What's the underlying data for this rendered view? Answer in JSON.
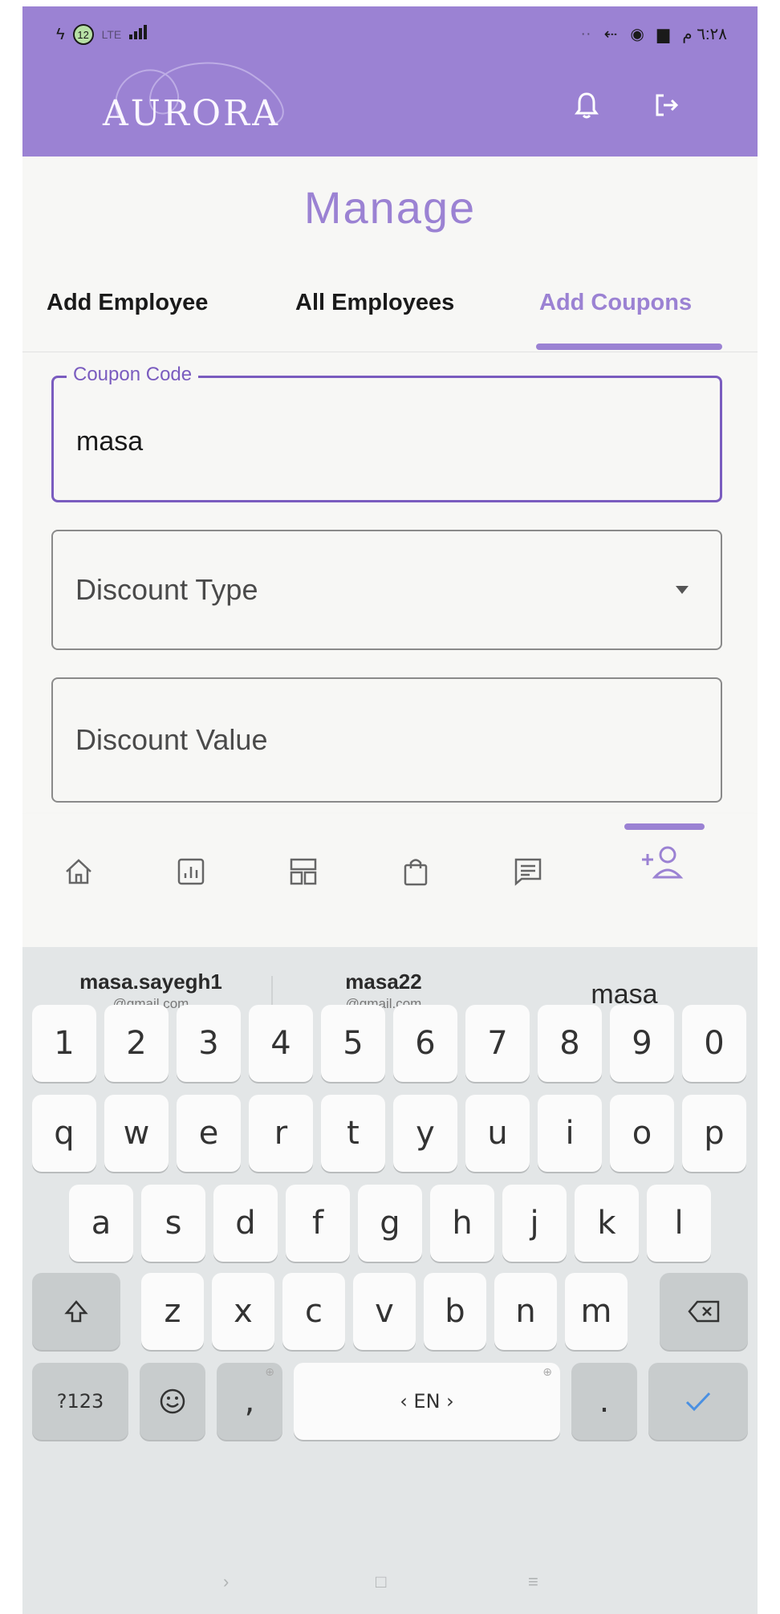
{
  "status_bar": {
    "left_badge": "12",
    "left_text": "LTE",
    "time": "٦:٢٨ م"
  },
  "header": {
    "logo": "AURORA",
    "icons": [
      "bell-icon",
      "logout-icon"
    ]
  },
  "page": {
    "title": "Manage",
    "tabs": [
      {
        "label": "Add Employee",
        "active": false
      },
      {
        "label": "All Employees",
        "active": false
      },
      {
        "label": "Add Coupons",
        "active": true
      }
    ]
  },
  "form": {
    "coupon_code": {
      "label": "Coupon Code",
      "value": "masa"
    },
    "discount_type": {
      "label": "Discount Type"
    },
    "discount_value": {
      "label": "Discount Value"
    }
  },
  "bottom_nav": {
    "items": [
      "home-icon",
      "chart-icon",
      "dashboard-icon",
      "shopping-bag-icon",
      "message-icon",
      "add-person-icon"
    ],
    "active_index": 5
  },
  "keyboard": {
    "suggestions": [
      {
        "main": "masa.sayegh1",
        "sub": "@gmail.com"
      },
      {
        "main": "masa22",
        "sub": "@gmail.com"
      },
      {
        "main": "masa"
      }
    ],
    "row1": [
      "1",
      "2",
      "3",
      "4",
      "5",
      "6",
      "7",
      "8",
      "9",
      "0"
    ],
    "row2": [
      "q",
      "w",
      "e",
      "r",
      "t",
      "y",
      "u",
      "i",
      "o",
      "p"
    ],
    "row3": [
      "a",
      "s",
      "d",
      "f",
      "g",
      "h",
      "j",
      "k",
      "l"
    ],
    "row4": [
      "z",
      "x",
      "c",
      "v",
      "b",
      "n",
      "m"
    ],
    "symbols_key": "?123",
    "space_label": "‹ EN ›",
    "comma": ",",
    "period": ".",
    "accent_color": "#4a90e2"
  },
  "colors": {
    "brand": "#9b82d3",
    "focus": "#7a5cbf"
  }
}
